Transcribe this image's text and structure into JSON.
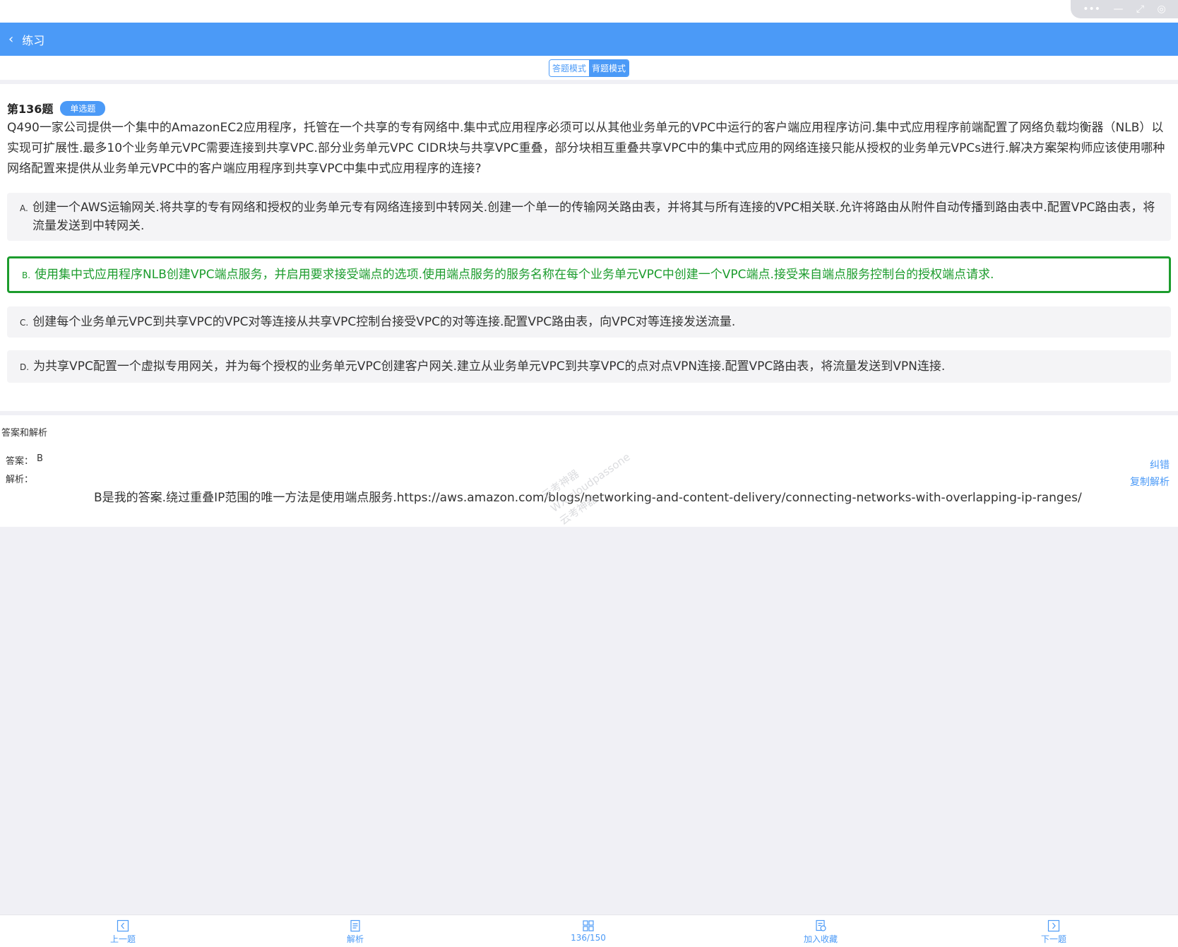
{
  "nav": {
    "back_icon": "‹",
    "title": "练习"
  },
  "capsule": {
    "more": "•••",
    "minimize": "—",
    "restore": "⤢",
    "close": "◎"
  },
  "modes": {
    "answer_mode": "答题模式",
    "memorize_mode": "背题模式",
    "active": "memorize_mode"
  },
  "question": {
    "number": "第136题",
    "type": "单选题",
    "text": "Q490一家公司提供一个集中的AmazonEC2应用程序，托管在一个共享的专有网络中.集中式应用程序必须可以从其他业务单元的VPC中运行的客户端应用程序访问.集中式应用程序前端配置了网络负载均衡器（NLB）以实现可扩展性.最多10个业务单元VPC需要连接到共享VPC.部分业务单元VPC CIDR块与共享VPC重叠，部分块相互重叠共享VPC中的集中式应用的网络连接只能从授权的业务单元VPCs进行.解决方案架构师应该使用哪种网络配置来提供从业务单元VPC中的客户端应用程序到共享VPC中集中式应用程序的连接?",
    "options": [
      {
        "letter": "A.",
        "text": "创建一个AWS运输网关.将共享的专有网络和授权的业务单元专有网络连接到中转网关.创建一个单一的传输网关路由表，并将其与所有连接的VPC相关联.允许将路由从附件自动传播到路由表中.配置VPC路由表，将流量发送到中转网关."
      },
      {
        "letter": "B.",
        "text": "使用集中式应用程序NLB创建VPC端点服务，并启用要求接受端点的选项.使用端点服务的服务名称在每个业务单元VPC中创建一个VPC端点.接受来自端点服务控制台的授权端点请求.",
        "correct": true
      },
      {
        "letter": "C.",
        "text": "创建每个业务单元VPC到共享VPC的VPC对等连接从共享VPC控制台接受VPC的对等连接.配置VPC路由表，向VPC对等连接发送流量."
      },
      {
        "letter": "D.",
        "text": "为共享VPC配置一个虚拟专用网关，并为每个授权的业务单元VPC创建客户网关.建立从业务单元VPC到共享VPC的点对点VPN连接.配置VPC路由表，将流量发送到VPN连接."
      }
    ]
  },
  "analysis": {
    "header": "答案和解析",
    "answer_label": "答案：",
    "answer_value": "B",
    "explanation_label": "解析：",
    "explanation_text": "B是我的答案.绕过重叠IP范围的唯一方法是使用端点服务.https://aws.amazon.com/blogs/networking-and-content-delivery/connecting-networks-with-overlapping-ip-ranges/",
    "correct_link": "纠错",
    "copy_link": "复制解析",
    "watermark_lines": [
      "云考神器",
      "WX:cloudpassone",
      "云考神器"
    ]
  },
  "bottom": {
    "prev": "上一题",
    "analysis": "解析",
    "progress": "136/150",
    "favorite": "加入收藏",
    "next": "下一题"
  },
  "colors": {
    "accent": "#4b9af7",
    "correct": "#1c9c2d"
  }
}
